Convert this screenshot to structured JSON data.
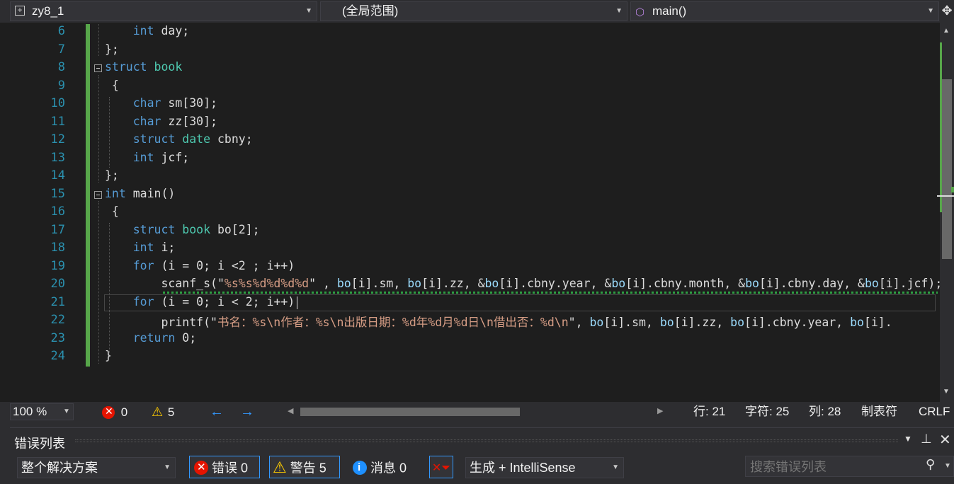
{
  "nav": {
    "project": "zy8_1",
    "scope": "(全局范围)",
    "member": "main()"
  },
  "editor": {
    "line_numbers": [
      "6",
      "7",
      "8",
      "9",
      "10",
      "11",
      "12",
      "13",
      "14",
      "15",
      "16",
      "17",
      "18",
      "19",
      "20",
      "21",
      "22",
      "23",
      "24"
    ],
    "lines": [
      [
        {
          "t": "    "
        },
        {
          "t": "int",
          "c": "kw"
        },
        {
          "t": " day;"
        }
      ],
      [
        {
          "t": "};"
        }
      ],
      [
        {
          "t": "struct",
          "c": "kw"
        },
        {
          "t": " "
        },
        {
          "t": "book",
          "c": "ty"
        }
      ],
      [
        {
          "t": " {"
        }
      ],
      [
        {
          "t": "    "
        },
        {
          "t": "char",
          "c": "kw"
        },
        {
          "t": " sm[30];"
        }
      ],
      [
        {
          "t": "    "
        },
        {
          "t": "char",
          "c": "kw"
        },
        {
          "t": " zz[30];"
        }
      ],
      [
        {
          "t": "    "
        },
        {
          "t": "struct",
          "c": "kw"
        },
        {
          "t": " "
        },
        {
          "t": "date",
          "c": "ty"
        },
        {
          "t": " cbny;"
        }
      ],
      [
        {
          "t": "    "
        },
        {
          "t": "int",
          "c": "kw"
        },
        {
          "t": " jcf;"
        }
      ],
      [
        {
          "t": "};"
        }
      ],
      [
        {
          "t": "int",
          "c": "kw"
        },
        {
          "t": " main()"
        }
      ],
      [
        {
          "t": " {"
        }
      ],
      [
        {
          "t": "    "
        },
        {
          "t": "struct",
          "c": "kw"
        },
        {
          "t": " "
        },
        {
          "t": "book",
          "c": "ty"
        },
        {
          "t": " bo[2];"
        }
      ],
      [
        {
          "t": "    "
        },
        {
          "t": "int",
          "c": "kw"
        },
        {
          "t": " i;"
        }
      ],
      [
        {
          "t": "    "
        },
        {
          "t": "for",
          "c": "kw"
        },
        {
          "t": " (i = 0; i <2 ; i++)"
        }
      ],
      [
        {
          "t": "        scanf_s(\""
        },
        {
          "t": "%s%s%d%d%d%d",
          "c": "str"
        },
        {
          "t": "\" , "
        },
        {
          "t": "bo",
          "c": "var"
        },
        {
          "t": "[i].sm, "
        },
        {
          "t": "bo",
          "c": "var"
        },
        {
          "t": "[i].zz, &"
        },
        {
          "t": "bo",
          "c": "var"
        },
        {
          "t": "[i].cbny.year, &"
        },
        {
          "t": "bo",
          "c": "var"
        },
        {
          "t": "[i].cbny.month, &"
        },
        {
          "t": "bo",
          "c": "var"
        },
        {
          "t": "[i].cbny.day, &"
        },
        {
          "t": "bo",
          "c": "var"
        },
        {
          "t": "[i].jcf);"
        }
      ],
      [
        {
          "t": "    "
        },
        {
          "t": "for",
          "c": "kw"
        },
        {
          "t": " (i = 0; i < 2; i++)"
        }
      ],
      [
        {
          "t": "        printf(\""
        },
        {
          "t": "书名：%s\\n作者：%s\\n出版日期：%d年%d月%d日\\n借出否：%d\\n",
          "c": "str"
        },
        {
          "t": "\", "
        },
        {
          "t": "bo",
          "c": "var"
        },
        {
          "t": "[i].sm, "
        },
        {
          "t": "bo",
          "c": "var"
        },
        {
          "t": "[i].zz, "
        },
        {
          "t": "bo",
          "c": "var"
        },
        {
          "t": "[i].cbny.year, "
        },
        {
          "t": "bo",
          "c": "var"
        },
        {
          "t": "[i]."
        }
      ],
      [
        {
          "t": "    "
        },
        {
          "t": "return",
          "c": "kw"
        },
        {
          "t": " 0;"
        }
      ],
      [
        {
          "t": "}"
        }
      ]
    ]
  },
  "status": {
    "zoom": "100 %",
    "errors": "0",
    "warnings": "5",
    "row": "行: 21",
    "char": "字符: 25",
    "col": "列: 28",
    "tab_mode": "制表符",
    "eol": "CRLF"
  },
  "error_list": {
    "title": "错误列表",
    "scope": "整个解决方案",
    "errors_label": "错误 0",
    "warnings_label": "警告 5",
    "messages_label": "消息 0",
    "source": "生成 + IntelliSense",
    "search_placeholder": "搜索错误列表"
  },
  "colors": {
    "background": "#1e1e1e",
    "keyword": "#569cd6",
    "type": "#4ec9b0",
    "string": "#d69d85",
    "line_number": "#2b91af",
    "accent": "#3399ff",
    "error": "#e51400",
    "warning": "#ffcc00"
  }
}
